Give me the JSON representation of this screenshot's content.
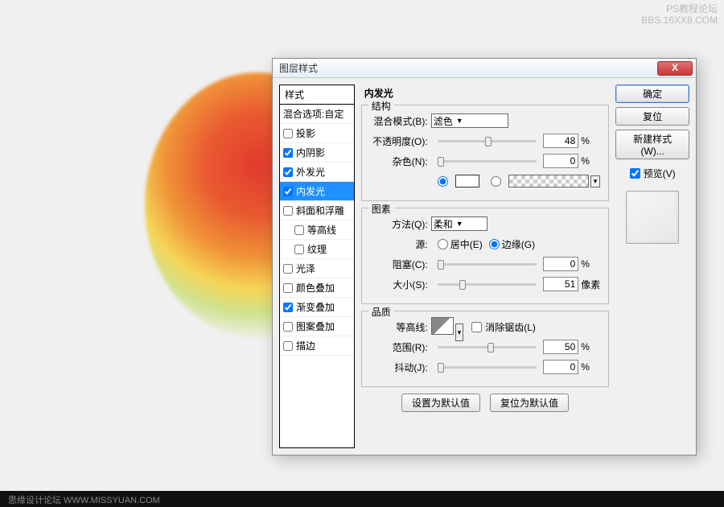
{
  "watermark_top_line1": "PS教程论坛",
  "watermark_top_line2": "BBS.16XX8.COM",
  "watermark_bottom": "思缘设计论坛  WWW.MISSYUAN.COM",
  "dialog": {
    "title": "图层样式",
    "close_x": "X"
  },
  "styles_header": "样式",
  "styles": [
    {
      "label": "混合选项:自定",
      "cb": false,
      "has_cb": false
    },
    {
      "label": "投影",
      "cb": false,
      "has_cb": true
    },
    {
      "label": "内阴影",
      "cb": true,
      "has_cb": true
    },
    {
      "label": "外发光",
      "cb": true,
      "has_cb": true
    },
    {
      "label": "内发光",
      "cb": true,
      "has_cb": true,
      "selected": true
    },
    {
      "label": "斜面和浮雕",
      "cb": false,
      "has_cb": true
    },
    {
      "label": "等高线",
      "cb": false,
      "has_cb": true,
      "indent": true
    },
    {
      "label": "纹理",
      "cb": false,
      "has_cb": true,
      "indent": true
    },
    {
      "label": "光泽",
      "cb": false,
      "has_cb": true
    },
    {
      "label": "颜色叠加",
      "cb": false,
      "has_cb": true
    },
    {
      "label": "渐变叠加",
      "cb": true,
      "has_cb": true
    },
    {
      "label": "图案叠加",
      "cb": false,
      "has_cb": true
    },
    {
      "label": "描边",
      "cb": false,
      "has_cb": true
    }
  ],
  "panel_title": "内发光",
  "group_structure": "结构",
  "blend_mode_label": "混合模式(B):",
  "blend_mode_value": "滤色",
  "opacity_label": "不透明度(O):",
  "opacity_value": "48",
  "noise_label": "杂色(N):",
  "noise_value": "0",
  "percent": "%",
  "group_elements": "图素",
  "technique_label": "方法(Q):",
  "technique_value": "柔和",
  "source_label": "源:",
  "source_center": "居中(E)",
  "source_edge": "边缘(G)",
  "choke_label": "阻塞(C):",
  "choke_value": "0",
  "size_label": "大小(S):",
  "size_value": "51",
  "px": "像素",
  "group_quality": "品质",
  "contour_label": "等高线:",
  "antialias_label": "消除锯齿(L)",
  "range_label": "范围(R):",
  "range_value": "50",
  "jitter_label": "抖动(J):",
  "jitter_value": "0",
  "btn_set_default": "设置为默认值",
  "btn_reset_default": "复位为默认值",
  "right": {
    "ok": "确定",
    "cancel": "复位",
    "new_style": "新建样式(W)...",
    "preview": "预览(V)"
  }
}
